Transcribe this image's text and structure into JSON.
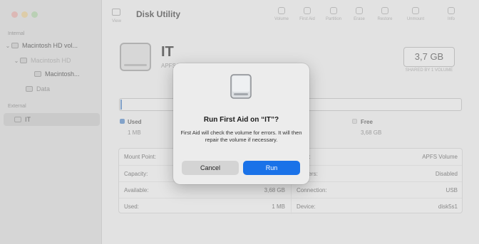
{
  "window": {
    "title": "Disk Utility"
  },
  "toolbar": {
    "view_label": "View",
    "actions": [
      {
        "label": "Volume",
        "icon": "volume-icon"
      },
      {
        "label": "First Aid",
        "icon": "first-aid-icon"
      },
      {
        "label": "Partition",
        "icon": "partition-icon"
      },
      {
        "label": "Erase",
        "icon": "erase-icon"
      },
      {
        "label": "Restore",
        "icon": "restore-icon"
      },
      {
        "label": "Unmount",
        "icon": "unmount-icon"
      },
      {
        "label": "Info",
        "icon": "info-icon"
      }
    ]
  },
  "sidebar": {
    "internal_label": "Internal",
    "external_label": "External",
    "items": [
      {
        "label": "Macintosh HD vol..."
      },
      {
        "label": "Macintosh HD"
      },
      {
        "label": "Macintosh..."
      },
      {
        "label": "Data"
      },
      {
        "label": "IT"
      }
    ]
  },
  "volume": {
    "name": "IT",
    "subtitle": "APFS Volume • APFS (Encrypted)",
    "capacity": "3,7 GB",
    "capacity_sub": "SHARED BY 1 VOLUME",
    "usage_fraction": 0.001
  },
  "legend": {
    "used_label": "Used",
    "used_value": "1 MB",
    "free_label": "Free",
    "free_value": "3,68 GB",
    "used_color": "#5a8fd0",
    "free_color": "#e4e4e4"
  },
  "info_table": {
    "left": [
      {
        "key": "Mount Point:",
        "value": ""
      },
      {
        "key": "Capacity:",
        "value": ""
      },
      {
        "key": "Available:",
        "value": "3,68 GB"
      },
      {
        "key": "Used:",
        "value": "1 MB"
      }
    ],
    "right": [
      {
        "key": "Type:",
        "value": "APFS Volume"
      },
      {
        "key": "Owners:",
        "value": "Disabled"
      },
      {
        "key": "Connection:",
        "value": "USB"
      },
      {
        "key": "Device:",
        "value": "disk5s1"
      }
    ]
  },
  "dialog": {
    "title": "Run First Aid on “IT”?",
    "message": "First Aid will check the volume for errors. It will then repair the volume if necessary.",
    "cancel_label": "Cancel",
    "run_label": "Run",
    "accent_color": "#1a72e8"
  }
}
